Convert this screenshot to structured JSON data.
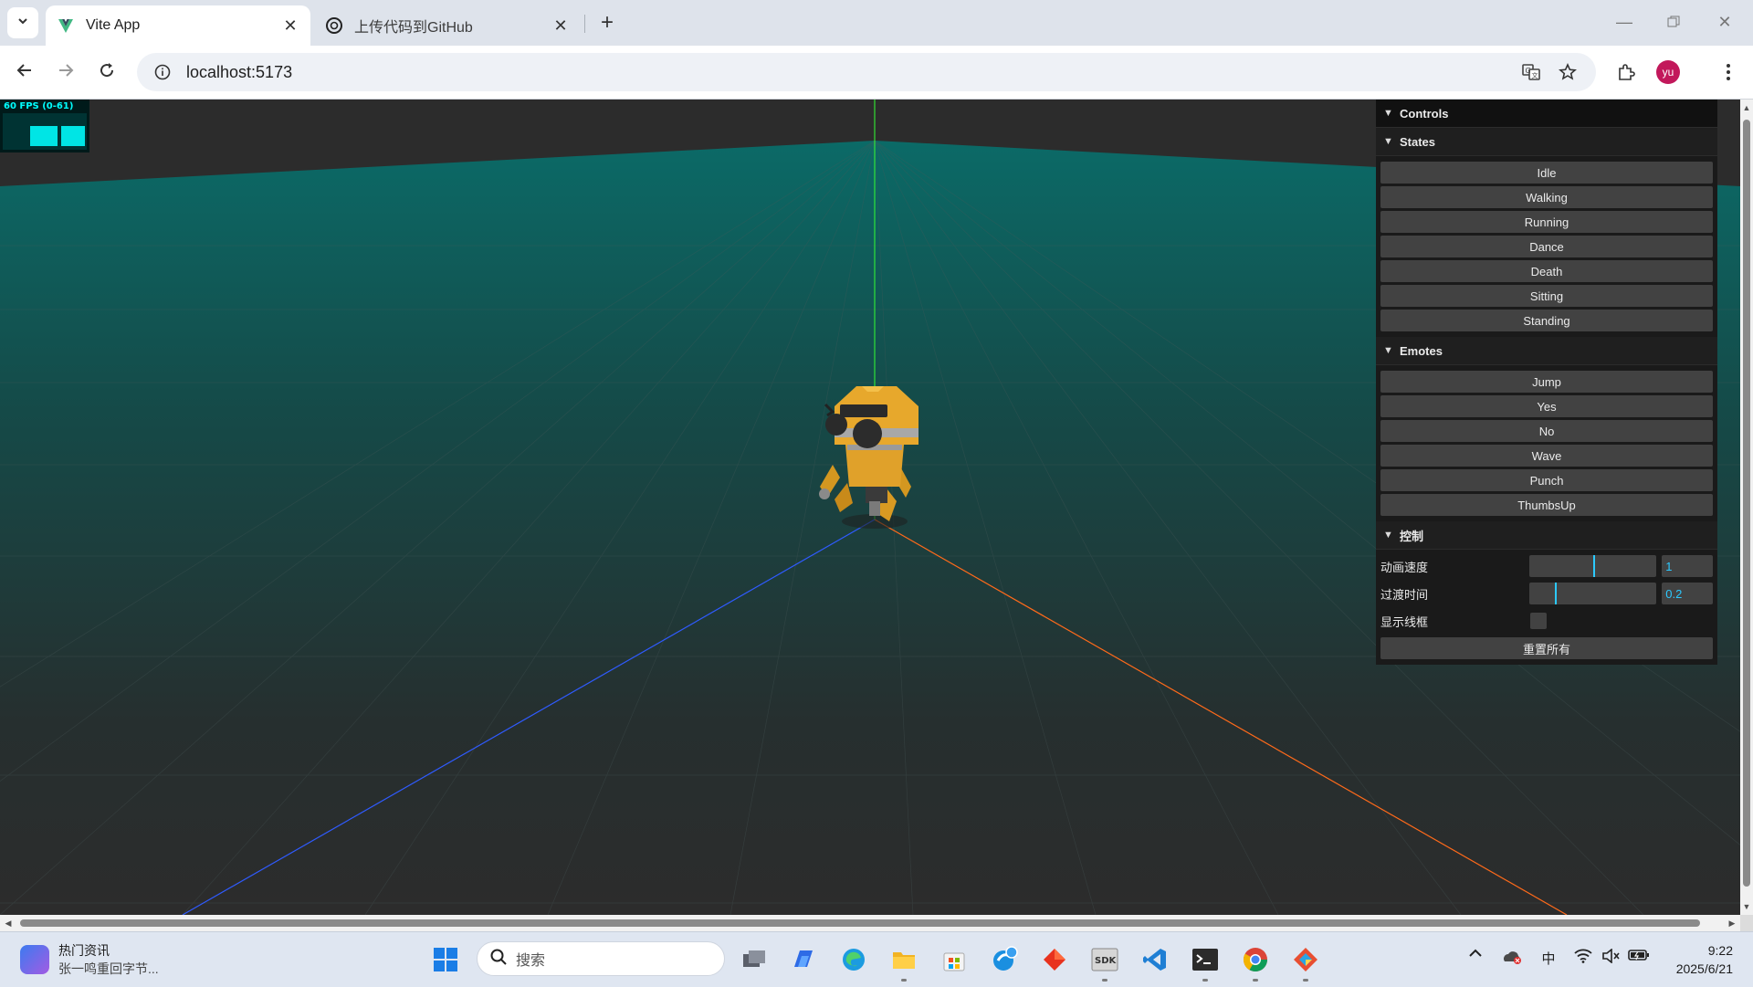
{
  "browser": {
    "tabs": [
      {
        "title": "Vite App",
        "active": true,
        "icon": "vite-logo-icon"
      },
      {
        "title": "上传代码到GitHub",
        "active": false,
        "icon": "openai-logo-icon"
      }
    ],
    "address": "localhost:5173",
    "profile_initials": "yu",
    "profile_color": "#c2185b"
  },
  "stats": {
    "fps_text": "60 FPS (0-61)",
    "color": "#00ffff"
  },
  "gui": {
    "title": "Controls",
    "folders": {
      "states": {
        "title": "States",
        "buttons": [
          "Idle",
          "Walking",
          "Running",
          "Dance",
          "Death",
          "Sitting",
          "Standing"
        ]
      },
      "emotes": {
        "title": "Emotes",
        "buttons": [
          "Jump",
          "Yes",
          "No",
          "Wave",
          "Punch",
          "ThumbsUp"
        ]
      },
      "control": {
        "title": "控制",
        "speed": {
          "label": "动画速度",
          "value": "1",
          "fraction": 0.5
        },
        "fade": {
          "label": "过渡时间",
          "value": "0.2",
          "fraction": 0.2
        },
        "wireframe": {
          "label": "显示线框",
          "checked": false
        },
        "reset_label": "重置所有"
      }
    },
    "accent": "#2cc9ff"
  },
  "scene": {
    "axis_colors": {
      "x": "#ff6a1a",
      "y": "#33ff33",
      "z": "#2f5bff"
    },
    "ground_color": "#0b6a67",
    "background": "#2c2c2c"
  },
  "taskbar": {
    "news_title": "热门资讯",
    "news_subtitle": "张一鸣重回字节...",
    "search_placeholder": "搜索",
    "ime": "中",
    "time": "9:22",
    "date": "2025/6/21",
    "apps": [
      "windows-start-icon",
      "task-view-icon",
      "copilot-icon",
      "edge-icon",
      "file-explorer-icon",
      "ms-store-icon",
      "browser-icon",
      "app-red-icon",
      "sdk-icon",
      "vscode-icon",
      "terminal-icon",
      "chrome-icon",
      "git-icon"
    ]
  }
}
